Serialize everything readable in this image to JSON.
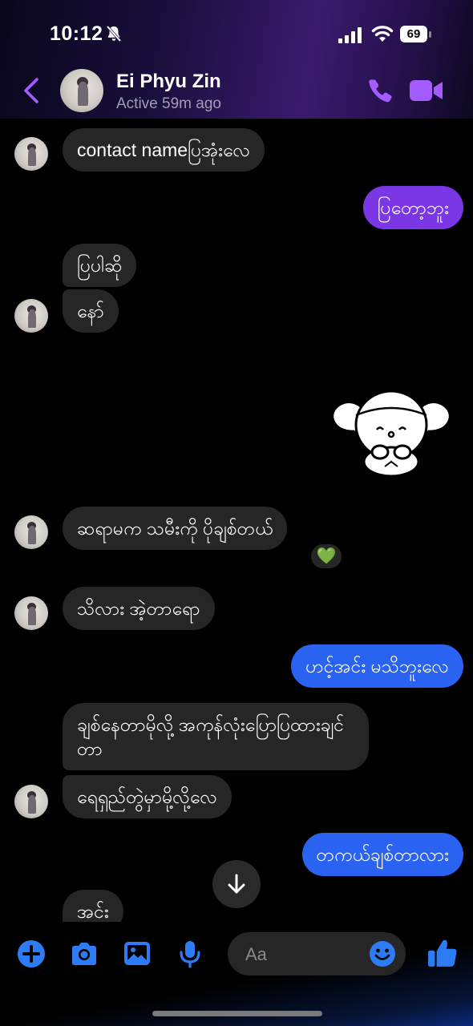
{
  "status_bar": {
    "time": "10:12",
    "battery": "69"
  },
  "header": {
    "contact_name": "Ei Phyu Zin",
    "contact_status": "Active 59m ago"
  },
  "messages": [
    {
      "side": "in",
      "text": "contact nameပြအုံးလေ"
    },
    {
      "side": "out",
      "text": "ပြတော့ဘူး"
    },
    {
      "side": "in",
      "text": "ပြပါဆို"
    },
    {
      "side": "in",
      "text": "နော်"
    },
    {
      "side": "out",
      "type": "sticker",
      "text": ""
    },
    {
      "side": "in",
      "text": "ဆရာမက သမီးကို ပိုချစ်တယ်",
      "reaction": "💚"
    },
    {
      "side": "in",
      "text": "သိလား အဲ့တာရော"
    },
    {
      "side": "out",
      "text": "ဟင့်အင်း မသိဘူးလေ"
    },
    {
      "side": "in",
      "text": "ချစ်နေတာမိုလို့ အကုန်လုံးပြောပြထားချင်တာ"
    },
    {
      "side": "in",
      "text": "ရေရှည်တွဲမှာမို့လို့လေ"
    },
    {
      "side": "out",
      "text": "တကယ်ချစ်တာလား"
    },
    {
      "side": "in",
      "text": "အင်း"
    }
  ],
  "composer": {
    "placeholder": "Aa"
  },
  "colors": {
    "accent": "#a35cff",
    "outgoing_purple": "#7b37e6",
    "outgoing_blue": "#2a63f1",
    "incoming": "#262626",
    "composer_icons": "#2e7bf6"
  }
}
